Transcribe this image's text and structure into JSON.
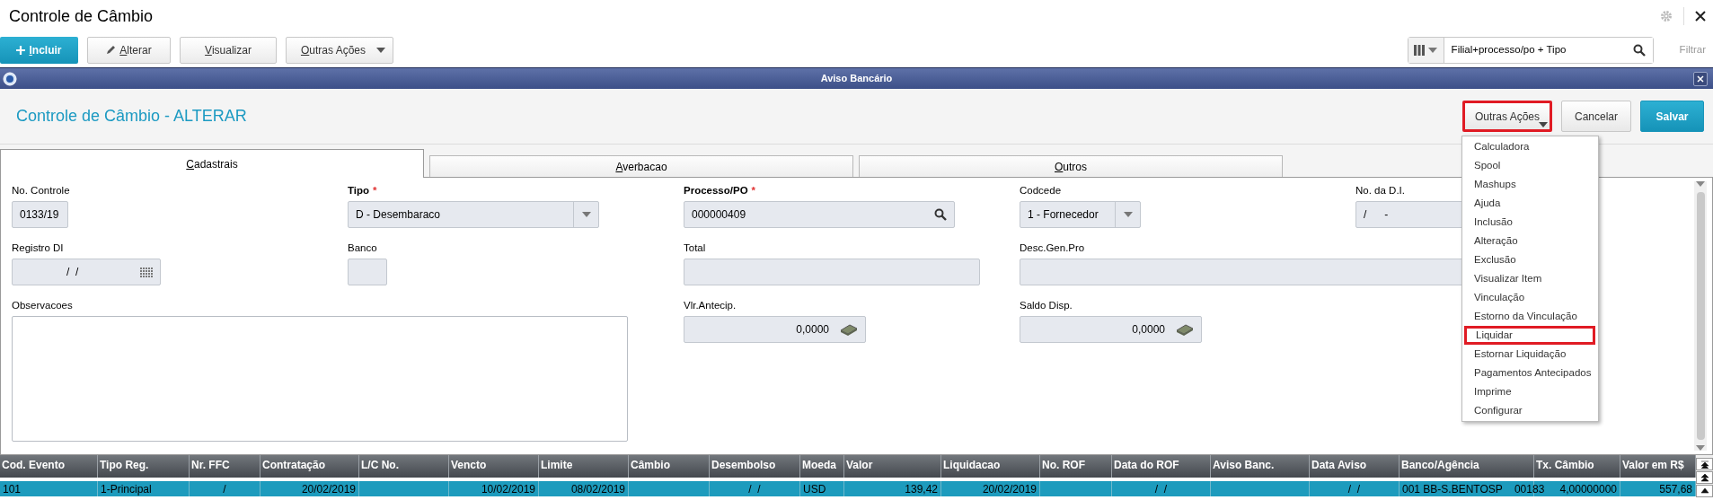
{
  "page_title": "Controle de Câmbio",
  "toolbar": {
    "buttons": [
      {
        "label": "Incluir",
        "kind": "primary"
      },
      {
        "label": "Alterar",
        "kind": "edit"
      },
      {
        "label": "Visualizar",
        "kind": "plain"
      },
      {
        "label": "Outras Ações",
        "kind": "menu"
      }
    ],
    "search": {
      "value": "Filial+processo/po + Tipo"
    },
    "filter_label": "Filtrar"
  },
  "dialog": {
    "title": "Aviso Bancário",
    "required_symbol": "*",
    "heading": "Controle de Câmbio - ALTERAR",
    "buttons": [
      {
        "label": "Outras Ações",
        "kind": "menu",
        "highlighted": true
      },
      {
        "label": "Cancelar",
        "kind": "secondary",
        "highlighted": false
      },
      {
        "label": "Salvar",
        "kind": "primary",
        "highlighted": false
      }
    ],
    "tabs": [
      {
        "label": "Cadastrais",
        "selected": true
      },
      {
        "label": "Averbacao",
        "selected": false
      },
      {
        "label": "Outros",
        "selected": false
      }
    ],
    "form_rows": [
      [
        {
          "label": "No. Controle",
          "required": false,
          "kind": "text",
          "value": "0133/19"
        },
        {
          "label": "Tipo",
          "required": true,
          "kind": "select",
          "value": "D - Desembaraco"
        },
        {
          "label": "Processo/PO",
          "required": true,
          "kind": "lookup",
          "value": "000000409"
        },
        {
          "label": "Codcede",
          "required": false,
          "kind": "select",
          "value": "1 - Fornecedor"
        },
        {
          "label": "No. da D.I.",
          "required": false,
          "kind": "text",
          "value": "/      -"
        }
      ],
      [
        {
          "label": "Registro DI",
          "required": false,
          "kind": "date",
          "value": "/  /"
        },
        {
          "label": "Banco",
          "required": false,
          "kind": "text"
        },
        {
          "label": "Total",
          "required": false,
          "kind": "text"
        },
        {
          "label": "Desc.Gen.Pro",
          "required": false,
          "kind": "text"
        }
      ],
      [
        {
          "label": "Observacoes",
          "required": false,
          "kind": "textarea"
        },
        {
          "label": "Vlr.Antecip.",
          "required": false,
          "kind": "money",
          "value": "0,0000"
        },
        {
          "label": "Saldo Disp.",
          "required": false,
          "kind": "money",
          "value": "0,0000"
        }
      ]
    ],
    "menu": [
      {
        "label": "Calculadora",
        "highlighted": false
      },
      {
        "label": "Spool",
        "highlighted": false
      },
      {
        "label": "Mashups",
        "highlighted": false
      },
      {
        "label": "Ajuda",
        "highlighted": false
      },
      {
        "label": "Inclusão",
        "highlighted": false
      },
      {
        "label": "Alteração",
        "highlighted": false
      },
      {
        "label": "Exclusão",
        "highlighted": false
      },
      {
        "label": "Visualizar Item",
        "highlighted": false
      },
      {
        "label": "Vinculação",
        "highlighted": false
      },
      {
        "label": "Estorno da Vinculação",
        "highlighted": false
      },
      {
        "label": "Liquidar",
        "highlighted": true
      },
      {
        "label": "Estornar Liquidação",
        "highlighted": false
      },
      {
        "label": "Pagamentos Antecipados",
        "highlighted": false
      },
      {
        "label": "Imprime",
        "highlighted": false
      },
      {
        "label": "Configurar",
        "highlighted": false
      }
    ]
  },
  "table": {
    "columns": [
      "Cod. Evento",
      "Tipo Reg.",
      "Nr. FFC",
      "Contratação",
      "L/C No.",
      "Vencto",
      "Limite",
      "Câmbio",
      "Desembolso",
      "Moeda",
      "Valor",
      "Liquidacao",
      "No. ROF",
      "Data do ROF",
      "Aviso Banc.",
      "Data Aviso",
      "Banco/Agência",
      "Tx. Câmbio",
      "Valor em R$"
    ],
    "rows": [
      {
        "selected": true,
        "cells": [
          "101",
          "1-Principal",
          "/",
          "20/02/2019",
          null,
          "10/02/2019",
          "08/02/2019",
          null,
          "/  /",
          "USD",
          "139,42",
          "20/02/2019",
          null,
          "/  /",
          null,
          "/  /",
          "001 BB-S.BENTOSP    00183",
          "4,00000000",
          "557,68"
        ]
      }
    ]
  }
}
